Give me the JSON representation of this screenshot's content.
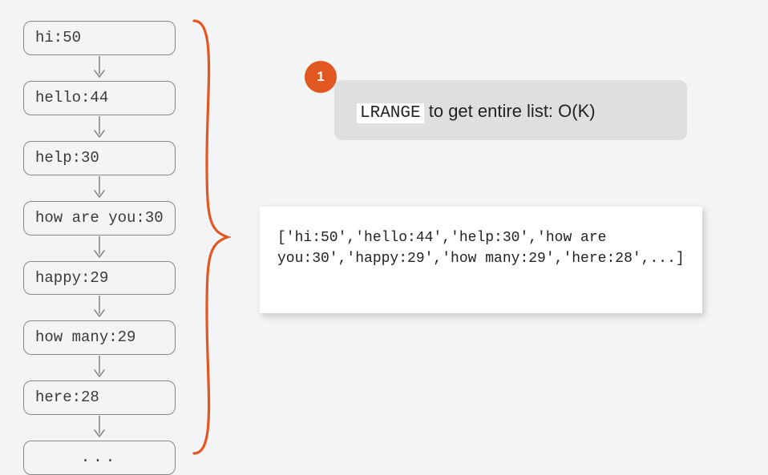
{
  "list": {
    "items": [
      "hi:50",
      "hello:44",
      "help:30",
      "how are you:30",
      "happy:29",
      "how many:29",
      "here:28",
      "..."
    ]
  },
  "callout": {
    "badge": "1",
    "code": "LRANGE",
    "rest": " to get entire list: O(K)"
  },
  "result": {
    "text": "['hi:50','hello:44','help:30','how are you:30','happy:29','how many:29','here:28',...]"
  },
  "colors": {
    "brace": "#e25822",
    "arrow": "#888888",
    "nodeBorder": "#888888"
  }
}
